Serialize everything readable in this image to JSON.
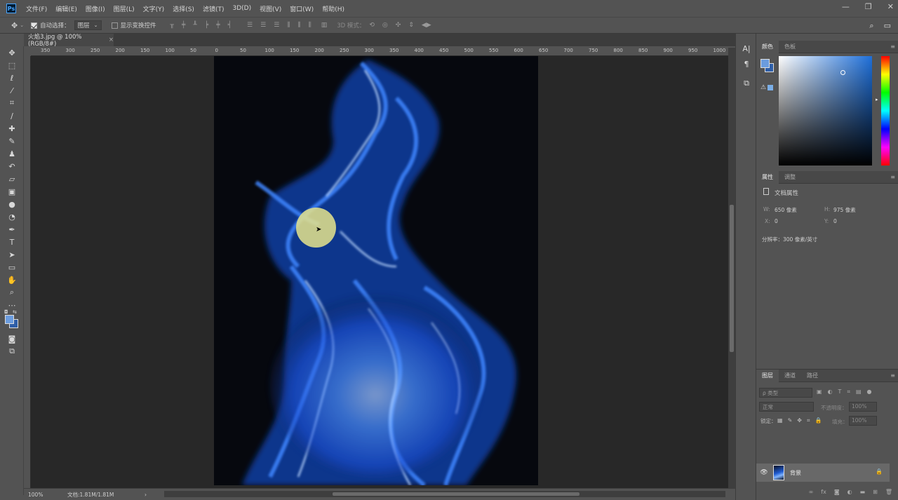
{
  "app": {
    "logo": "Ps"
  },
  "menu": [
    "文件(F)",
    "编辑(E)",
    "图像(I)",
    "图层(L)",
    "文字(Y)",
    "选择(S)",
    "滤镜(T)",
    "3D(D)",
    "视图(V)",
    "窗口(W)",
    "帮助(H)"
  ],
  "window_controls": {
    "minimize": "—",
    "restore": "❐",
    "close": "✕"
  },
  "options": {
    "auto_select_label": "自动选择：",
    "auto_select_checked": true,
    "auto_select_target": "图层",
    "show_transform_label": "显示变换控件",
    "show_transform_checked": false,
    "mode_3d_label": "3D 模式："
  },
  "document_tab": {
    "title": "火焰3.jpg @ 100%(RGB/8#)",
    "close": "×"
  },
  "ruler": {
    "h_labels": [
      "350",
      "300",
      "250",
      "200",
      "150",
      "100",
      "50",
      "0",
      "50",
      "100",
      "150",
      "200",
      "250",
      "300",
      "350",
      "400",
      "450",
      "500",
      "550",
      "600",
      "650",
      "700",
      "750",
      "800",
      "850",
      "900",
      "950",
      "1000"
    ]
  },
  "status": {
    "zoom": "100%",
    "doc_info": "文档:1.81M/1.81M",
    "arrow": "›"
  },
  "colors": {
    "foreground": "#6b9cde",
    "background": "#2e5ea8",
    "accent": "#4aa4ff"
  },
  "color_panel": {
    "tabs": [
      "颜色",
      "色板"
    ]
  },
  "properties_panel": {
    "tabs": [
      "属性",
      "调整"
    ],
    "section_title": "文档属性",
    "w_label": "W:",
    "w_value": "650 像素",
    "h_label": "H:",
    "h_value": "975 像素",
    "x_label": "X:",
    "x_value": "0",
    "y_label": "Y:",
    "y_value": "0",
    "resolution": "分辨率：300 像素/英寸"
  },
  "layers_panel": {
    "tabs": [
      "图层",
      "通道",
      "路径"
    ],
    "filter_placeholder": "ρ 类型",
    "blend_mode": "正常",
    "opacity_label": "不透明度：",
    "opacity_value": "100%",
    "lock_label": "锁定：",
    "fill_label": "填充：",
    "fill_value": "100%",
    "layers": [
      {
        "name": "背景",
        "visible": true,
        "locked": true
      }
    ]
  }
}
